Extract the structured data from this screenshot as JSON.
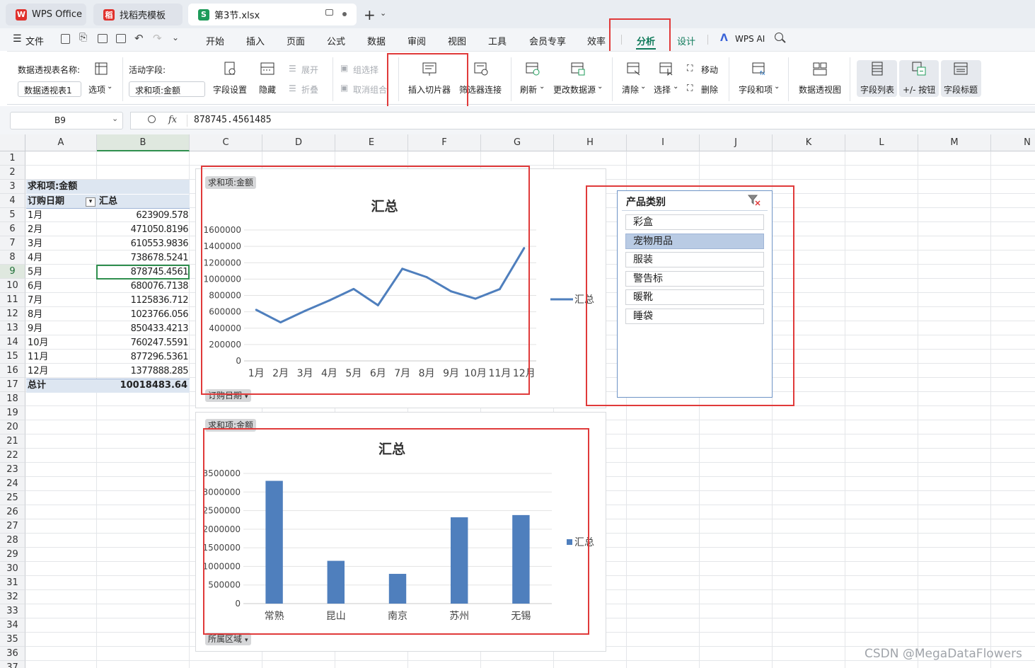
{
  "tabs": [
    {
      "label": "WPS Office",
      "logo": "W"
    },
    {
      "label": "找稻壳模板",
      "logo": "稻"
    },
    {
      "label": "第3节.xlsx",
      "logo": "S"
    }
  ],
  "menu": {
    "file": "文件",
    "items": [
      "开始",
      "插入",
      "页面",
      "公式",
      "数据",
      "审阅",
      "视图",
      "工具",
      "会员专享",
      "效率",
      "分析",
      "设计"
    ],
    "active": "分析",
    "wps_ai": "WPS AI"
  },
  "ribbon": {
    "pivot_name_label": "数据透视表名称:",
    "pivot_name_value": "数据透视表1",
    "options": "选项",
    "active_field_label": "活动字段:",
    "active_field_value": "求和项:金额",
    "field_settings": "字段设置",
    "hide": "隐藏",
    "expand": "展开",
    "collapse": "折叠",
    "group_select": "组选择",
    "ungroup": "取消组合",
    "insert_slicer": "插入切片器",
    "filter_connect": "筛选器连接",
    "refresh": "刷新",
    "change_source": "更改数据源",
    "clear": "清除",
    "select": "选择",
    "move": "移动",
    "delete": "删除",
    "fields_items": "字段和项",
    "pivot_chart": "数据透视图",
    "field_list": "字段列表",
    "plus_minus": "+/- 按钮",
    "field_headers": "字段标题"
  },
  "formula_bar": {
    "name_box": "B9",
    "fx": "fx",
    "value": "878745.4561485"
  },
  "columns": [
    "A",
    "B",
    "C",
    "D",
    "E",
    "F",
    "G",
    "H",
    "I",
    "J",
    "K",
    "L",
    "M",
    "N"
  ],
  "rows": [
    "1",
    "2",
    "3",
    "4",
    "5",
    "6",
    "7",
    "8",
    "9",
    "10",
    "11",
    "12",
    "13",
    "14",
    "15",
    "16",
    "17",
    "18",
    "19",
    "20",
    "21",
    "22",
    "23",
    "24",
    "25",
    "26",
    "27",
    "28",
    "29",
    "30",
    "31",
    "32",
    "33",
    "34",
    "35",
    "36",
    "37"
  ],
  "pivot": {
    "header": "求和项:金额",
    "col_a": "订购日期",
    "col_b": "汇总",
    "rows": [
      {
        "label": "1月",
        "value": "623909.578"
      },
      {
        "label": "2月",
        "value": "471050.8196"
      },
      {
        "label": "3月",
        "value": "610553.9836"
      },
      {
        "label": "4月",
        "value": "738678.5241"
      },
      {
        "label": "5月",
        "value": "878745.4561"
      },
      {
        "label": "6月",
        "value": "680076.7138"
      },
      {
        "label": "7月",
        "value": "1125836.712"
      },
      {
        "label": "8月",
        "value": "1023766.056"
      },
      {
        "label": "9月",
        "value": "850433.4213"
      },
      {
        "label": "10月",
        "value": "760247.5591"
      },
      {
        "label": "11月",
        "value": "877296.5361"
      },
      {
        "label": "12月",
        "value": "1377888.285"
      }
    ],
    "total_label": "总计",
    "total_value": "10018483.64"
  },
  "chart_data": [
    {
      "type": "line",
      "title": "汇总",
      "value_field_button": "求和项:金额",
      "axis_field_button": "订购日期",
      "categories": [
        "1月",
        "2月",
        "3月",
        "4月",
        "5月",
        "6月",
        "7月",
        "8月",
        "9月",
        "10月",
        "11月",
        "12月"
      ],
      "series": [
        {
          "name": "汇总",
          "values": [
            623909.578,
            471050.8196,
            610553.9836,
            738678.5241,
            878745.4561,
            680076.7138,
            1125836.712,
            1023766.056,
            850433.4213,
            760247.5591,
            877296.5361,
            1377888.285
          ],
          "color": "#4f7fbd"
        }
      ],
      "ylim": [
        0,
        1600000
      ],
      "yticks": [
        0,
        200000,
        400000,
        600000,
        800000,
        1000000,
        1200000,
        1400000,
        1600000
      ],
      "legend": "right",
      "grid": true
    },
    {
      "type": "bar",
      "title": "汇总",
      "value_field_button": "求和项:金额",
      "axis_field_button": "所属区域",
      "categories": [
        "常熟",
        "昆山",
        "南京",
        "苏州",
        "无锡"
      ],
      "series": [
        {
          "name": "汇总",
          "values": [
            3300000,
            1150000,
            800000,
            2320000,
            2380000
          ],
          "color": "#4f7fbd"
        }
      ],
      "ylim": [
        0,
        3500000
      ],
      "yticks": [
        0,
        500000,
        1000000,
        1500000,
        2000000,
        2500000,
        3000000,
        3500000
      ],
      "legend": "right",
      "grid": true
    }
  ],
  "slicer": {
    "title": "产品类别",
    "items": [
      "彩盒",
      "宠物用品",
      "服装",
      "警告标",
      "暖靴",
      "睡袋"
    ],
    "selected": "宠物用品"
  },
  "watermark": "CSDN @MegaDataFlowers",
  "colors": {
    "accent": "#0f7a5a",
    "highlight": "#e03a3a",
    "series": "#4f7fbd"
  }
}
